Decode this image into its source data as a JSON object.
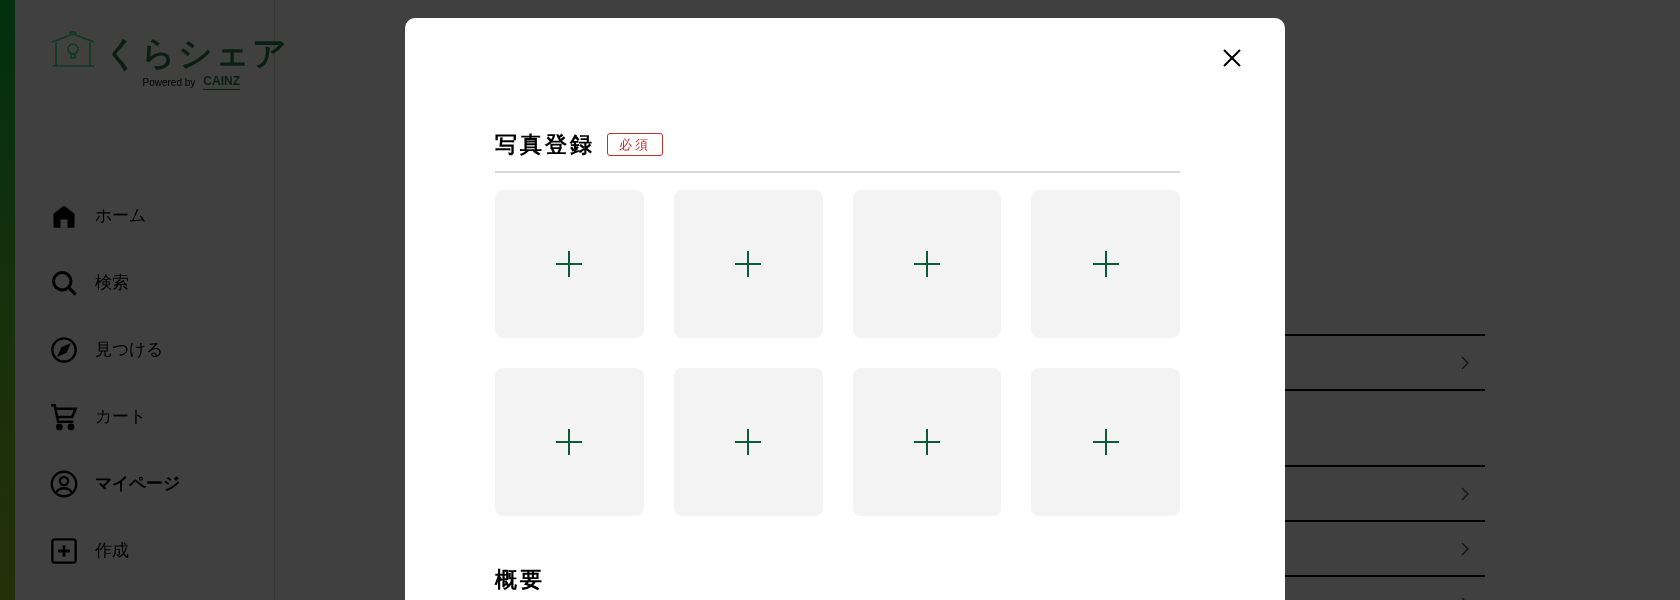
{
  "logo": {
    "name": "くらシェア",
    "powered_by": "Powered by",
    "brand": "CAINZ"
  },
  "sidebar": {
    "items": [
      {
        "label": "ホーム",
        "kind": "home",
        "selected": false
      },
      {
        "label": "検索",
        "kind": "search",
        "selected": false
      },
      {
        "label": "見つける",
        "kind": "compass",
        "selected": false
      },
      {
        "label": "カート",
        "kind": "cart",
        "selected": false
      },
      {
        "label": "マイページ",
        "kind": "user",
        "selected": true
      },
      {
        "label": "作成",
        "kind": "plus",
        "selected": false
      }
    ]
  },
  "background_list": [
    {
      "kind": "link"
    },
    {
      "kind": "blank"
    },
    {
      "kind": "link"
    },
    {
      "kind": "link"
    },
    {
      "kind": "link"
    }
  ],
  "modal": {
    "sections": [
      {
        "title": "写真登録",
        "badge": "必須",
        "photo_slots": [
          {
            "kind": "empty"
          },
          {
            "kind": "empty"
          },
          {
            "kind": "empty"
          },
          {
            "kind": "empty"
          },
          {
            "kind": "empty"
          },
          {
            "kind": "empty"
          },
          {
            "kind": "empty"
          },
          {
            "kind": "empty"
          }
        ]
      },
      {
        "title": "概要"
      }
    ]
  }
}
